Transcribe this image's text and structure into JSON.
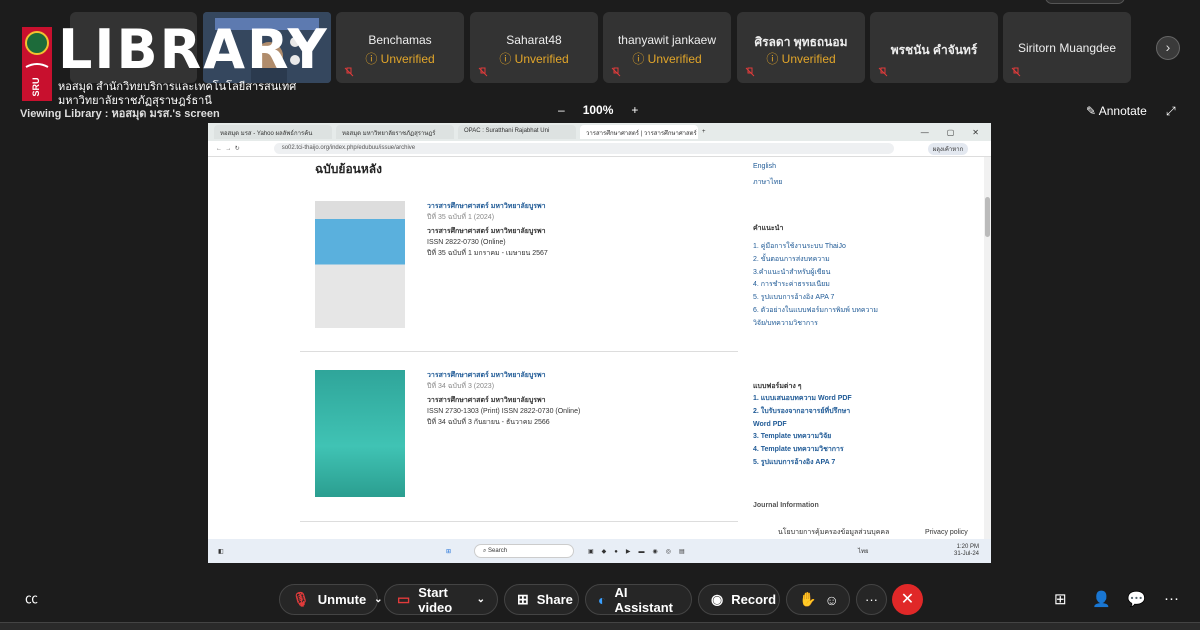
{
  "participants": [
    {
      "name": "Benchamas",
      "status": "Unverified"
    },
    {
      "name": "Saharat48",
      "status": "Unverified"
    },
    {
      "name": "thanyawit jankaew",
      "status": "Unverified"
    },
    {
      "name": "ศิรลดา พุทธถนอม",
      "status": "Unverified"
    },
    {
      "name": "พรชนัน คำจันทร์",
      "status": ""
    },
    {
      "name": "Siritorn Muangdee",
      "status": ""
    }
  ],
  "logo": {
    "seal_text": "SRU",
    "word": "LIBRARY",
    "line1": "หอสมุด สำนักวิทยบริการและเทคโนโลยีสารสนเทศ",
    "line2": "มหาวิทยาลัยราชภัฏสุราษฎร์ธานี"
  },
  "viewing_label": "Viewing Library : หอสมุด มรส.'s screen",
  "zoom": {
    "minus": "–",
    "level": "100%",
    "plus": "+"
  },
  "annotate_label": "Annotate",
  "browser": {
    "tabs": [
      "หอสมุด มรส - Yahoo ผลลัพธ์การค้น",
      "หอสมุด มหาวิทยาลัยราชภัฏสุราษฎร์",
      "OPAC : Suratthani Rajabhat Uni",
      "วารสารศึกษาศาสตร์ | วารสารศึกษาศาสตร์"
    ],
    "url": "so02.tci-thaijo.org/index.php/edubuu/issue/archive",
    "profile": "ผลุงเค้าหาก"
  },
  "page": {
    "heading": "ฉบับย้อนหลัง",
    "issues": [
      {
        "journal": "วารสารศึกษาศาสตร์ มหาวิทยาลัยบูรพา",
        "volume": "ปีที่ 35 ฉบับที่ 1 (2024)",
        "title": "วารสารศึกษาศาสตร์ มหาวิทยาลัยบูรพา",
        "issn": "ISSN 2822-0730 (Online)",
        "period": "ปีที่ 35 ฉบับที่ 1 มกราคม - เมษายน 2567"
      },
      {
        "journal": "วารสารศึกษาศาสตร์ มหาวิทยาลัยบูรพา",
        "volume": "ปีที่ 34 ฉบับที่ 3 (2023)",
        "title": "วารสารศึกษาศาสตร์ มหาวิทยาลัยบูรพา",
        "issn": "ISSN 2730-1303 (Print) ISSN 2822-0730 (Online)",
        "period": "ปีที่ 34 ฉบับที่ 3 กันยายน - ธันวาคม 2566"
      }
    ],
    "sidebar": {
      "lang_top": "English",
      "lang": "ภาษาไทย",
      "advice_heading": "คำแนะนำ",
      "advice": [
        "1. คู่มือการใช้งานระบบ ThaiJo",
        "2. ขั้นตอนการส่งบทความ",
        "3.คำแนะนำสำหรับผู้เขียน",
        "4. การชำระค่าธรรมเนียม",
        "5. รูปแบบการอ้างอิง APA 7",
        "6. ตัวอย่างในแบบฟอร์มการพิมพ์ บทความ",
        "วิจัย/บทความวิชาการ"
      ],
      "forms_heading": "แบบฟอร์มต่าง ๆ",
      "forms": [
        "1. แบบเสนอบทความ Word PDF",
        "2. ใบรับรองจากอาจารย์ที่ปรึกษา",
        "Word PDF",
        "3. Template บทความวิจัย",
        "4. Template บทความวิชาการ",
        "5. รูปแบบการอ้างอิง APA 7"
      ],
      "journal_info": "Journal Information",
      "privacy": "นโยบายการคุ้มครองข้อมูลส่วนบุคคล",
      "privacy_policy": "Privacy policy"
    },
    "taskbar": {
      "search": "Search",
      "time": "1:20 PM",
      "date": "31-Jul-24",
      "lang": "ไทย"
    }
  },
  "controls": {
    "unmute": "Unmute",
    "start_video": "Start video",
    "share": "Share",
    "ai_assistant": "AI Assistant",
    "record": "Record",
    "more": "···",
    "end": "✕"
  },
  "accent_colors": {
    "unverified": "#e2a62a",
    "end_call": "#e02828",
    "link": "#1f5a96"
  }
}
